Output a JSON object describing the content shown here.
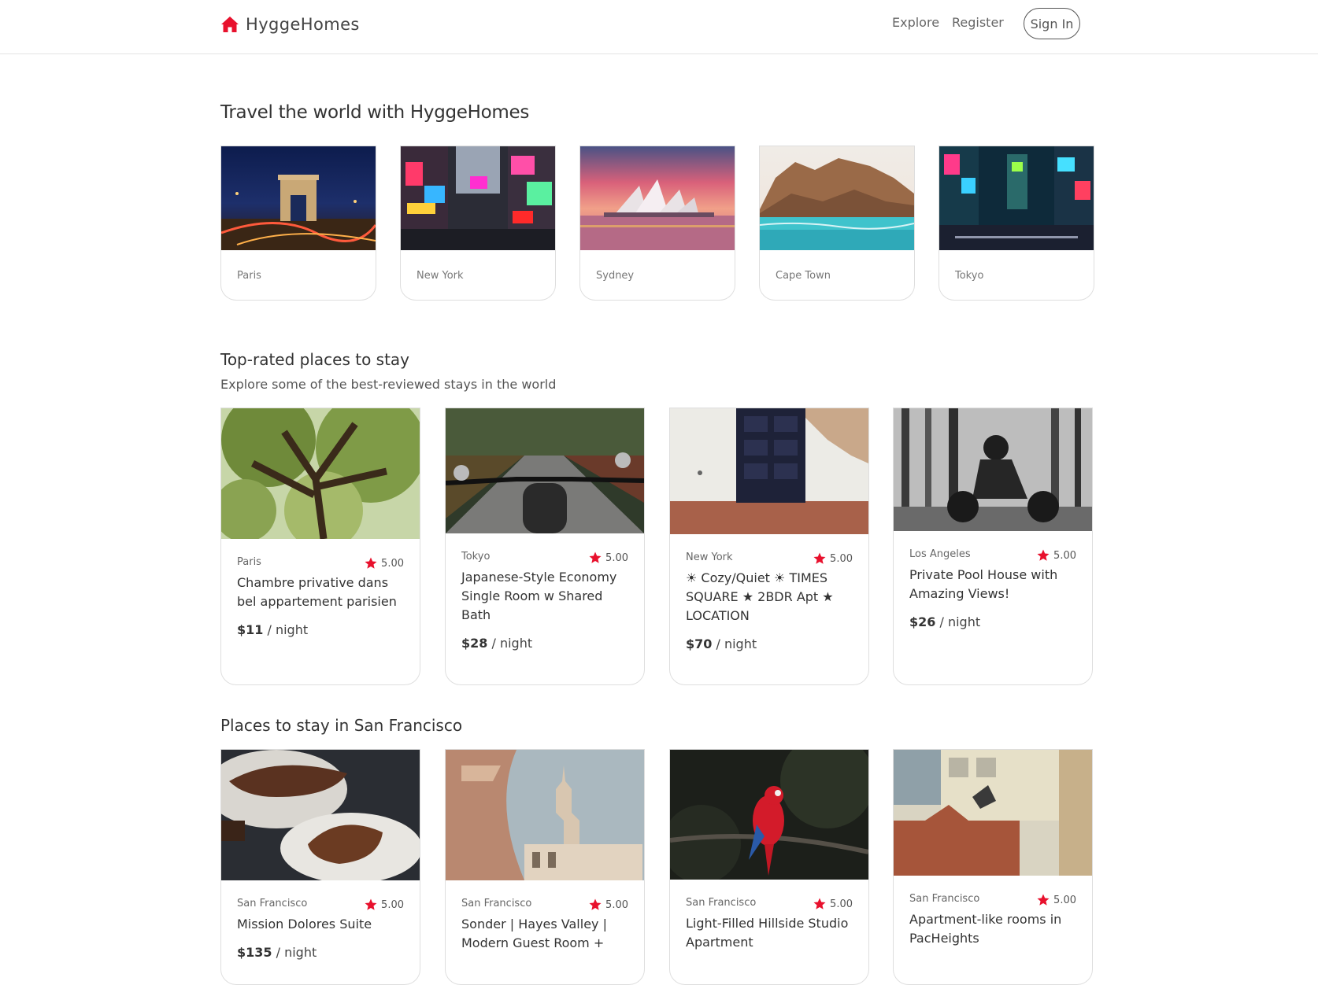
{
  "nav": {
    "brand": "HyggeHomes",
    "explore": "Explore",
    "register": "Register",
    "sign_in": "Sign In"
  },
  "travel": {
    "heading": "Travel the world with HyggeHomes",
    "cities": [
      {
        "name": "Paris"
      },
      {
        "name": "New York"
      },
      {
        "name": "Sydney"
      },
      {
        "name": "Cape Town"
      },
      {
        "name": "Tokyo"
      }
    ]
  },
  "top_rated": {
    "heading": "Top-rated places to stay",
    "subheading": "Explore some of the best-reviewed stays in the world",
    "listings": [
      {
        "location": "Paris",
        "rating": "5.00",
        "title": "Chambre privative dans bel appartement parisien",
        "price": "$11",
        "unit": " / night"
      },
      {
        "location": "Tokyo",
        "rating": "5.00",
        "title": "Japanese-Style Economy Single Room w Shared Bath",
        "price": "$28",
        "unit": " / night"
      },
      {
        "location": "New York",
        "rating": "5.00",
        "title": "☀ Cozy/Quiet ☀ TIMES SQUARE ★ 2BDR Apt ★ LOCATION",
        "price": "$70",
        "unit": " / night"
      },
      {
        "location": "Los Angeles",
        "rating": "5.00",
        "title": "Private Pool House with Amazing Views!",
        "price": "$26",
        "unit": " / night"
      }
    ]
  },
  "san_francisco": {
    "heading": "Places to stay in San Francisco",
    "listings": [
      {
        "location": "San Francisco",
        "rating": "5.00",
        "title": "Mission Dolores Suite",
        "price": "$135",
        "unit": " / night"
      },
      {
        "location": "San Francisco",
        "rating": "5.00",
        "title": "Sonder | Hayes Valley | Modern Guest Room +"
      },
      {
        "location": "San Francisco",
        "rating": "5.00",
        "title": "Light-Filled Hillside Studio Apartment"
      },
      {
        "location": "San Francisco",
        "rating": "5.00",
        "title": "Apartment-like rooms in PacHeights"
      }
    ]
  },
  "colors": {
    "brand_red": "#e8112d",
    "star_red": "#e8112d",
    "text": "#333333",
    "border": "#dedede"
  }
}
